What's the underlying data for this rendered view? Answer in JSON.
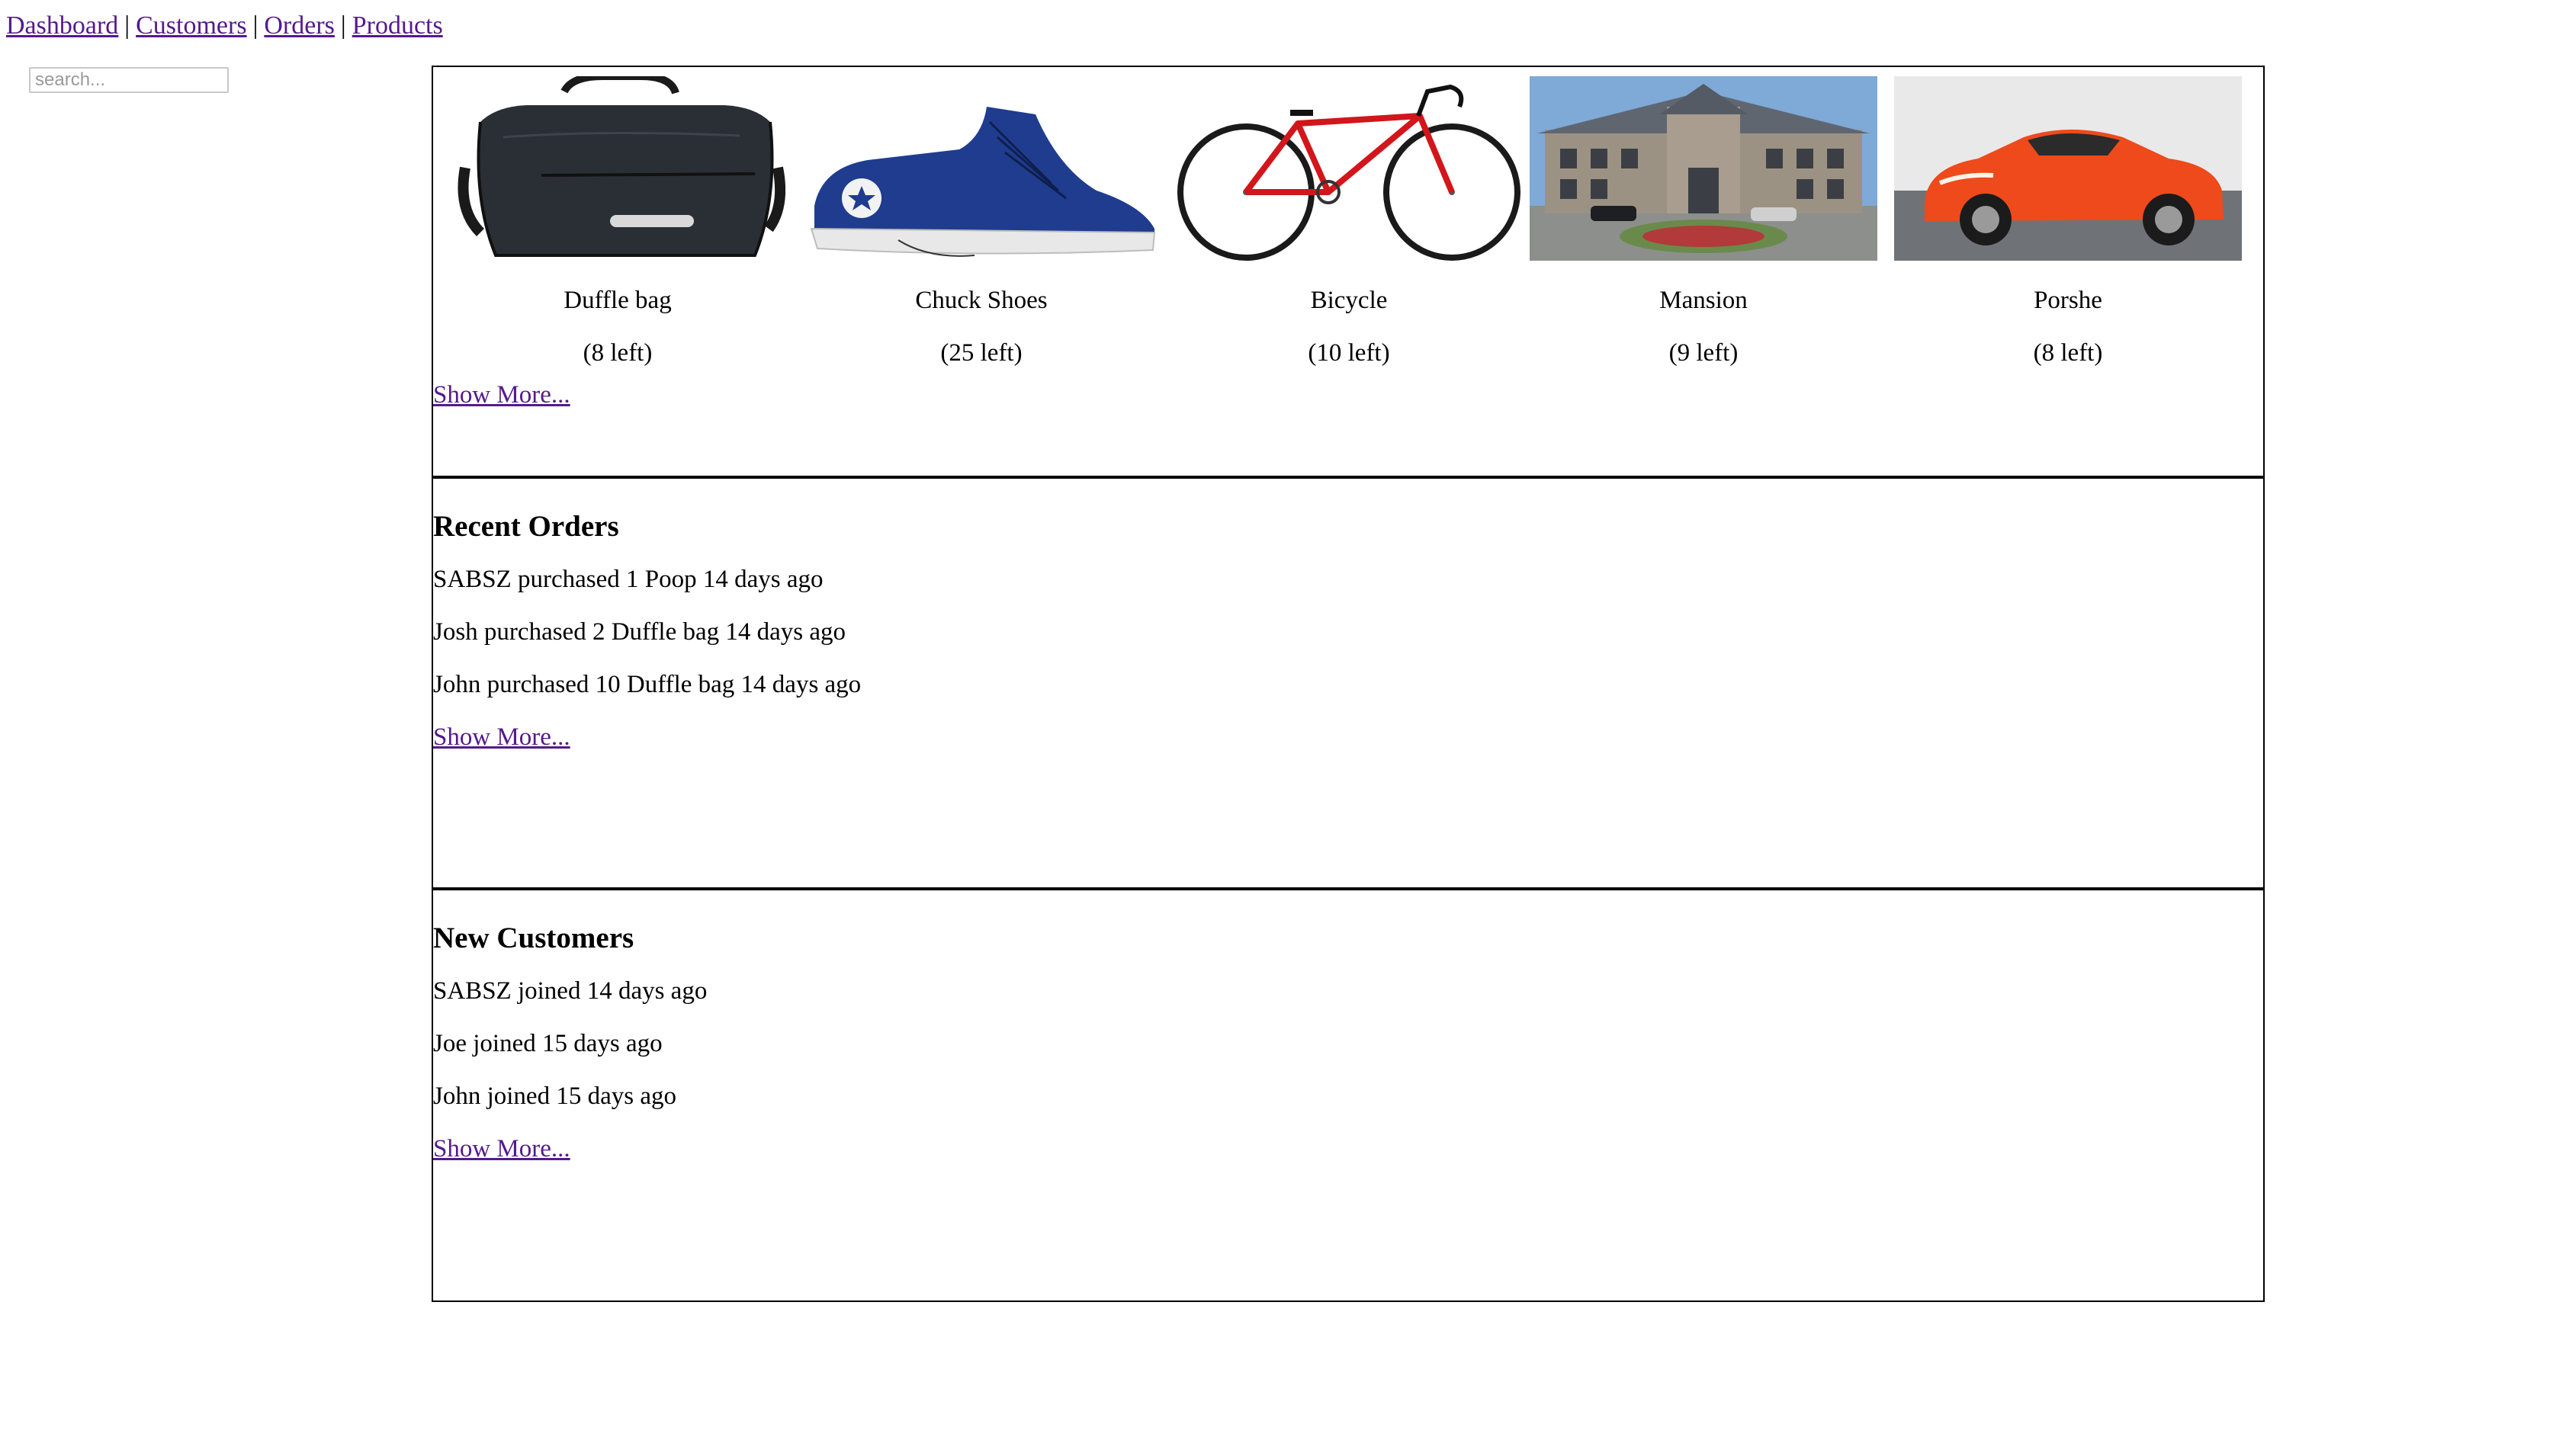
{
  "nav": {
    "links": [
      "Dashboard",
      "Customers",
      "Orders",
      "Products"
    ],
    "separator": "|"
  },
  "search": {
    "placeholder": "search...",
    "value": ""
  },
  "products": {
    "items": [
      {
        "name": "Duffle bag",
        "stock": "(8 left)",
        "image": "duffle-bag-image"
      },
      {
        "name": "Chuck Shoes",
        "stock": "(25 left)",
        "image": "sneaker-image"
      },
      {
        "name": "Bicycle",
        "stock": "(10 left)",
        "image": "bicycle-image"
      },
      {
        "name": "Mansion",
        "stock": "(9 left)",
        "image": "mansion-image"
      },
      {
        "name": "Porshe",
        "stock": "(8 left)",
        "image": "sports-car-image"
      }
    ],
    "show_more": "Show More..."
  },
  "recent_orders": {
    "title": "Recent Orders",
    "items": [
      "SABSZ purchased 1 Poop 14 days ago",
      "Josh purchased 2 Duffle bag 14 days ago",
      "John purchased 10 Duffle bag 14 days ago"
    ],
    "show_more": "Show More..."
  },
  "new_customers": {
    "title": "New Customers",
    "items": [
      "SABSZ joined 14 days ago",
      "Joe joined 15 days ago",
      "John joined 15 days ago"
    ],
    "show_more": "Show More..."
  },
  "colors": {
    "link": "#551a8b",
    "border": "#000000",
    "background": "#ffffff"
  }
}
